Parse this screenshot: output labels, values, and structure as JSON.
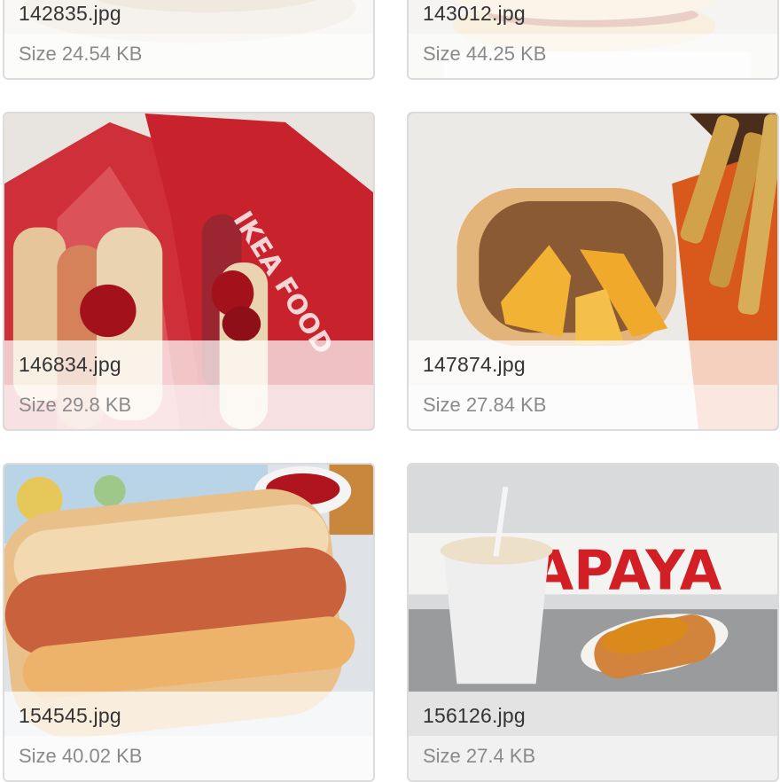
{
  "images": [
    {
      "filename": "142835.jpg",
      "size_text": "Size 24.54 KB"
    },
    {
      "filename": "143012.jpg",
      "size_text": "Size 44.25 KB"
    },
    {
      "filename": "146834.jpg",
      "size_text": "Size 29.8 KB",
      "thumb_text": "IKEA FOOD"
    },
    {
      "filename": "147874.jpg",
      "size_text": "Size 27.84 KB"
    },
    {
      "filename": "154545.jpg",
      "size_text": "Size 40.02 KB"
    },
    {
      "filename": "156126.jpg",
      "size_text": "Size 27.4 KB",
      "thumb_text": "APAYA"
    }
  ],
  "colors": {
    "ikea_red": "#c8232d",
    "ketchup": "#a3111a",
    "mustard_cheese": "#f2b233",
    "bun": "#e7b87a",
    "sausage": "#c9623c"
  }
}
